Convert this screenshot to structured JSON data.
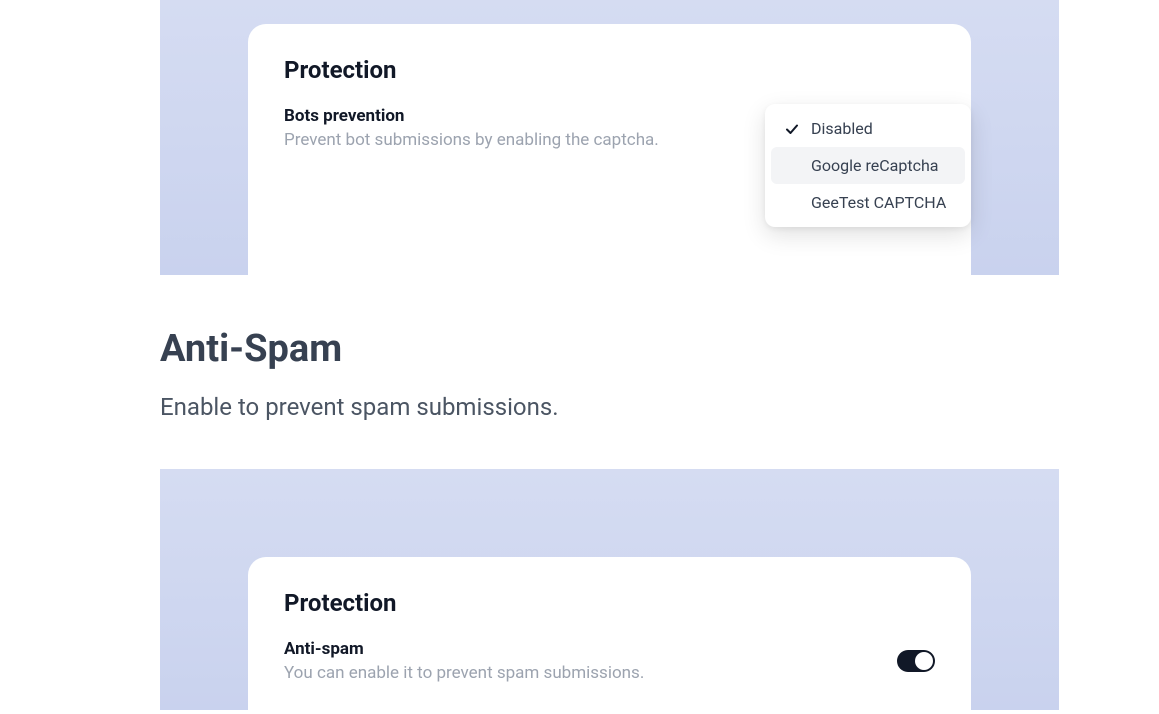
{
  "card1": {
    "title": "Protection",
    "setting": {
      "label": "Bots prevention",
      "description": "Prevent bot submissions by enabling the captcha."
    },
    "dropdown": {
      "items": [
        {
          "label": "Disabled",
          "selected": true
        },
        {
          "label": "Google reCaptcha",
          "selected": false
        },
        {
          "label": "GeeTest CAPTCHA",
          "selected": false
        }
      ]
    }
  },
  "section": {
    "heading": "Anti-Spam",
    "subtitle": "Enable to prevent spam submissions."
  },
  "card2": {
    "title": "Protection",
    "setting": {
      "label": "Anti-spam",
      "description": "You can enable it to prevent spam submissions."
    },
    "toggle": {
      "on": true
    }
  }
}
